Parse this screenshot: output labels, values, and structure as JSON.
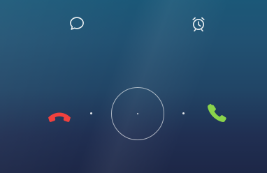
{
  "screen": {
    "background_top": "#1b5878",
    "background_bottom": "#1d2747"
  },
  "top_actions": {
    "message": {
      "icon": "message-bubble-icon"
    },
    "reminder": {
      "icon": "alarm-clock-icon"
    }
  },
  "call_controls": {
    "decline": {
      "icon": "hang-up-phone-icon",
      "color": "#f0413e"
    },
    "accept": {
      "icon": "phone-icon",
      "color": "#8ad34b"
    },
    "slider": {
      "icon": "slide-ring"
    }
  }
}
